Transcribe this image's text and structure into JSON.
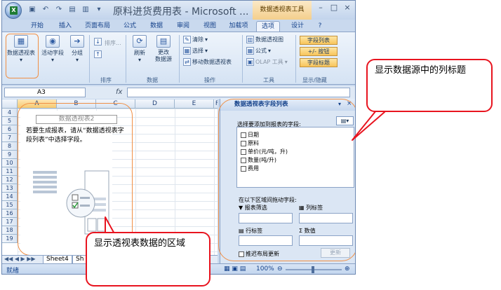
{
  "window": {
    "title": "原料进货费用表 - Microsoft ...",
    "context_tab_group": "数据透视表工具",
    "controls": [
      "–",
      "□",
      "×"
    ]
  },
  "tabs": [
    "开始",
    "插入",
    "页面布局",
    "公式",
    "数据",
    "审阅",
    "视图",
    "加载项",
    "选项",
    "设计"
  ],
  "active_tab": "选项",
  "ribbon": {
    "pivot_group": {
      "btn_pivot": "数据透视表",
      "btn_active_field": "活动字段",
      "btn_group": "分组"
    },
    "sort_group": {
      "btn_sort": "排序...",
      "label": "排序"
    },
    "data_group": {
      "btn_refresh": "刷新",
      "btn_change_source": "更改\n数据源",
      "label": "数据"
    },
    "actions_group": {
      "clear": "清除",
      "select": "选择",
      "move_pivot": "移动数据透视表",
      "label": "操作"
    },
    "tools_group": {
      "pivot_chart": "数据透视图",
      "formula": "公式",
      "olap": "OLAP 工具",
      "label": "工具"
    },
    "show_hide_group": {
      "field_list": "字段列表",
      "buttons": "+/- 按钮",
      "headers": "字段标题",
      "label": "显示/隐藏"
    }
  },
  "formula_bar": {
    "name_box": "A3",
    "fx": "fx",
    "content": ""
  },
  "grid": {
    "columns": [
      "A",
      "B",
      "C",
      "D",
      "E",
      "F"
    ],
    "selected_column": "A",
    "rows": [
      "4",
      "5",
      "6",
      "7",
      "8",
      "9",
      "10",
      "11",
      "12",
      "13",
      "14",
      "15",
      "16",
      "17",
      "18",
      "19"
    ]
  },
  "pivot_placeholder": {
    "name": "数据透视表2",
    "instructions": "若要生成报表，请从“数据透视表字段列表”中选择字段。"
  },
  "sheet_tabs": [
    "Sheet4",
    "Sh"
  ],
  "status_bar": {
    "ready": "就绪",
    "zoom": "100%"
  },
  "field_list": {
    "title": "数据透视表字段列表",
    "choose_label": "选择要添加到报表的字段:",
    "fields": [
      "日期",
      "原料",
      "单价(元/吨，升)",
      "数量(吨/升)",
      "费用"
    ],
    "areas_label": "在以下区域间拖动字段:",
    "report_filter": "报表筛选",
    "column_labels": "列标签",
    "row_labels": "行标签",
    "values": "数值",
    "defer_update": "推迟布局更新",
    "update_button": "更新"
  },
  "callouts": {
    "right": "显示数据源中的列标题",
    "bottom": "显示透视表数据的区域"
  }
}
